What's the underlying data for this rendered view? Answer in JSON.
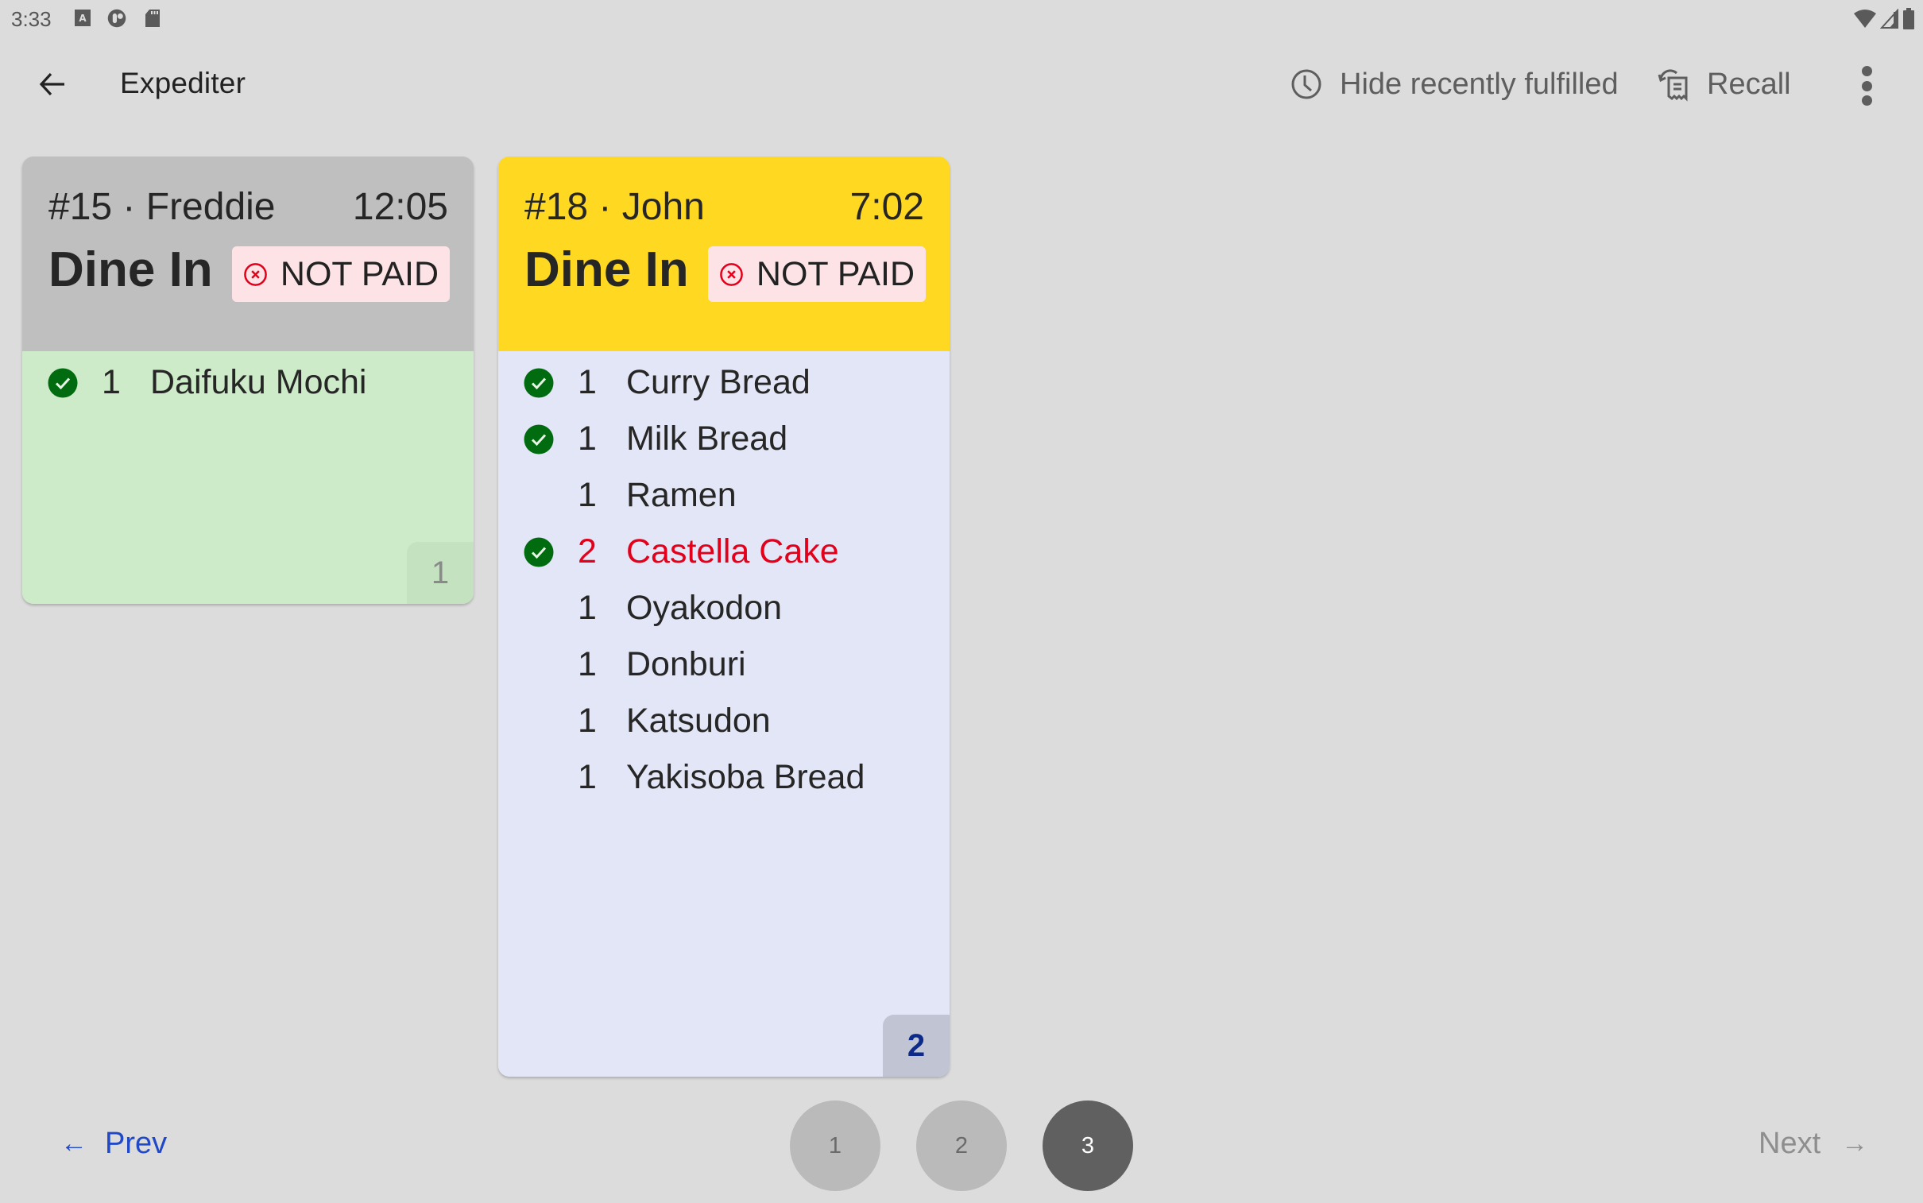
{
  "status_bar": {
    "time": "3:33",
    "icons": [
      "keyboard-a-icon",
      "app-circle-icon",
      "sd-card-icon"
    ],
    "right_icons": [
      "wifi-icon",
      "cell-signal-icon",
      "battery-icon"
    ]
  },
  "app_bar": {
    "back_icon": "arrow-back-icon",
    "title": "Expediter",
    "actions": [
      {
        "label": "Hide recently fulfilled",
        "icon": "clock-icon"
      },
      {
        "label": "Recall",
        "icon": "receipt-recall-icon"
      }
    ],
    "overflow_icon": "more-vert-icon"
  },
  "orders": [
    {
      "number": "#15",
      "customer": "Freddie",
      "id_line": "#15 · Freddie",
      "elapsed": "12:05",
      "type": "Dine In",
      "payment_status": "NOT PAID",
      "header_color": "#bfbfbf",
      "body_color": "#cdebc8",
      "item_count": "1",
      "count_bg": "#c4e1c0",
      "count_color": "#8a8a8a",
      "items": [
        {
          "qty": "1",
          "name": "Daifuku Mochi",
          "done": true,
          "alert": false
        }
      ]
    },
    {
      "number": "#18",
      "customer": "John",
      "id_line": "#18 · John",
      "elapsed": "7:02",
      "type": "Dine In",
      "payment_status": "NOT PAID",
      "header_color": "#ffd822",
      "body_color": "#e3e6f6",
      "item_count": "2",
      "count_bg": "#c1c5d3",
      "count_color": "#0d2a8a",
      "items": [
        {
          "qty": "1",
          "name": "Curry Bread",
          "done": true,
          "alert": false
        },
        {
          "qty": "1",
          "name": "Milk Bread",
          "done": true,
          "alert": false
        },
        {
          "qty": "1",
          "name": "Ramen",
          "done": false,
          "alert": false
        },
        {
          "qty": "2",
          "name": "Castella Cake",
          "done": true,
          "alert": true
        },
        {
          "qty": "1",
          "name": "Oyakodon",
          "done": false,
          "alert": false
        },
        {
          "qty": "1",
          "name": "Donburi",
          "done": false,
          "alert": false
        },
        {
          "qty": "1",
          "name": "Katsudon",
          "done": false,
          "alert": false
        },
        {
          "qty": "1",
          "name": "Yakisoba Bread",
          "done": false,
          "alert": false
        }
      ]
    }
  ],
  "pagination": {
    "prev_label": "Prev",
    "prev_arrow": "←",
    "next_label": "Next",
    "next_arrow": "→",
    "pages": [
      "1",
      "2",
      "3"
    ],
    "current_page": "3"
  },
  "colors": {
    "background": "#dcdcdc",
    "check_green": "#006b0f",
    "alert_red": "#e3001b",
    "not_paid_bg": "#fde3e6",
    "prev_link": "#2149c7",
    "page_inactive": "#bababa",
    "page_active": "#606060"
  }
}
